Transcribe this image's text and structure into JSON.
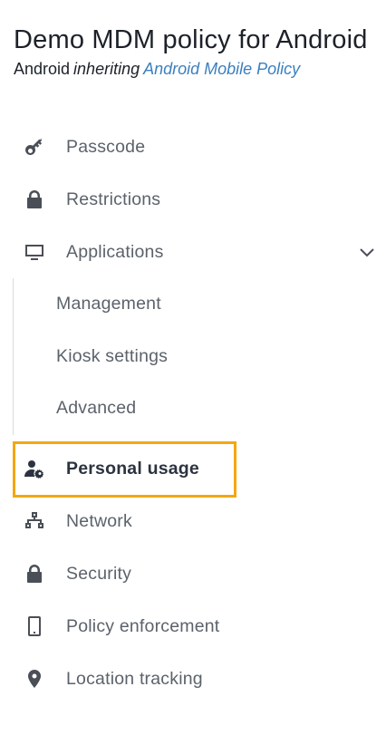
{
  "header": {
    "title": "Demo MDM policy for Android",
    "platform": "Android",
    "inheriting": "inheriting",
    "parent_policy": "Android Mobile Policy"
  },
  "nav": {
    "passcode": "Passcode",
    "restrictions": "Restrictions",
    "applications": "Applications",
    "applications_sub": {
      "management": "Management",
      "kiosk": "Kiosk settings",
      "advanced": "Advanced"
    },
    "personal_usage": "Personal usage",
    "network": "Network",
    "security": "Security",
    "policy_enforcement": "Policy enforcement",
    "location_tracking": "Location tracking"
  },
  "colors": {
    "highlight": "#f3a712",
    "link": "#3b7fbf"
  }
}
